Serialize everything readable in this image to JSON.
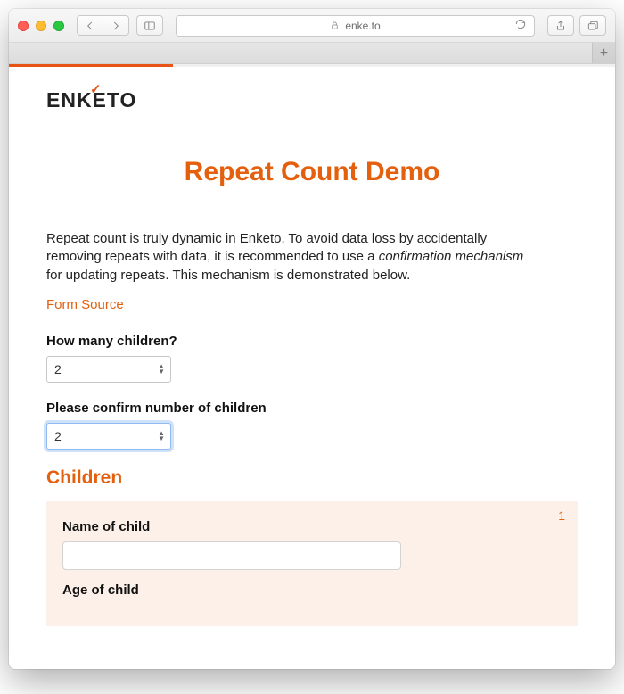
{
  "browser": {
    "url_host": "enke.to"
  },
  "progress": {
    "percent": 27
  },
  "logo": {
    "text": "ENKETO"
  },
  "page": {
    "title": "Repeat Count Demo",
    "intro_1": "Repeat count is truly dynamic in Enketo. To avoid data loss by accidentally removing repeats with data, it is recommended to use a ",
    "intro_em": "confirmation mechanism",
    "intro_2": " for updating repeats. This mechanism is demonstrated below.",
    "source_link": "Form Source"
  },
  "form": {
    "q1_label": "How many children?",
    "q1_value": "2",
    "q2_label": "Please confirm number of children",
    "q2_value": "2",
    "section_heading": "Children",
    "repeat": {
      "index": "1",
      "name_label": "Name of child",
      "name_value": "",
      "age_label": "Age of child"
    }
  }
}
